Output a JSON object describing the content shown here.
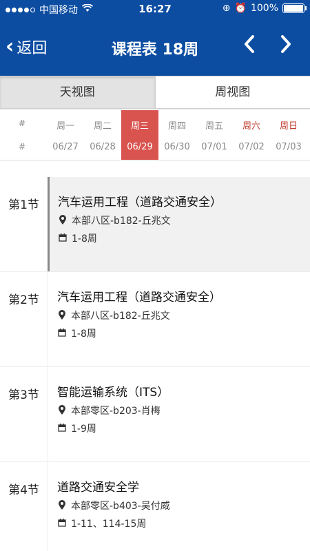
{
  "status": {
    "carrier": "中国移动",
    "time": "16:27",
    "battery": "100%",
    "battery_level": 1.0
  },
  "nav": {
    "back_label": "返回",
    "title": "课程表 18周",
    "prev": "<",
    "next": ">"
  },
  "tabs": [
    {
      "label": "天视图",
      "active": true
    },
    {
      "label": "周视图",
      "active": false
    }
  ],
  "week": {
    "hash_day": "#",
    "hash_date": "#",
    "days": [
      {
        "day": "周一",
        "date": "06/27"
      },
      {
        "day": "周二",
        "date": "06/28"
      },
      {
        "day": "周三",
        "date": "06/29"
      },
      {
        "day": "周四",
        "date": "06/30"
      },
      {
        "day": "周五",
        "date": "07/01"
      },
      {
        "day": "周六",
        "date": "07/02"
      },
      {
        "day": "周日",
        "date": "07/03"
      }
    ]
  },
  "schedule": [
    {
      "period": "第1节",
      "course": "汽车运用工程（道路交通安全）",
      "location": "本部八区-b182-丘兆文",
      "weeks": "1-8周"
    },
    {
      "period": "第2节",
      "course": "汽车运用工程（道路交通安全）",
      "location": "本部八区-b182-丘兆文",
      "weeks": "1-8周"
    },
    {
      "period": "第3节",
      "course": "智能运输系统（ITS）",
      "location": "本部零区-b203-肖梅",
      "weeks": "1-9周"
    },
    {
      "period": "第4节",
      "course": "道路交通安全学",
      "location": "本部零区-b403-吴付威",
      "weeks": "1-11、114-15周"
    }
  ],
  "colors": {
    "nav_bg": "#0c4da2",
    "today": "#d9534f",
    "weekend": "#c0392b"
  },
  "icons": [
    "location-pin-icon",
    "calendar-icon",
    "chevron-left-icon",
    "chevron-right-icon",
    "wifi-icon",
    "alarm-icon",
    "battery-icon"
  ]
}
